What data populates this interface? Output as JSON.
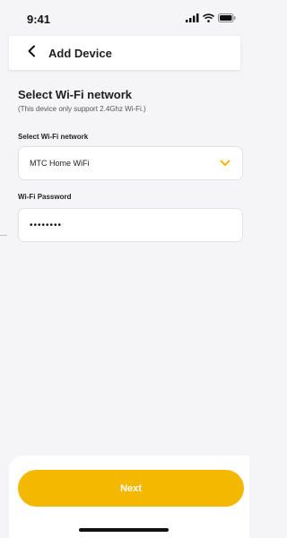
{
  "status_bar": {
    "time": "9:41",
    "icons": [
      "signal-icon",
      "wifi-icon",
      "battery-icon"
    ]
  },
  "header": {
    "title": "Add Device",
    "back_icon": "chevron-left-icon"
  },
  "section": {
    "title": "Select Wi-Fi network",
    "note": "(This device only support 2.4Ghz Wi-Fi.)"
  },
  "wifi_select": {
    "label": "Select Wi-Fi network",
    "value": "MTC Home WiFi",
    "icon": "chevron-down-icon",
    "icon_color": "#f5b800"
  },
  "password": {
    "label": "Wi-Fi Password",
    "value": "••••••••"
  },
  "footer": {
    "next_label": "Next",
    "accent": "#f5b800"
  }
}
